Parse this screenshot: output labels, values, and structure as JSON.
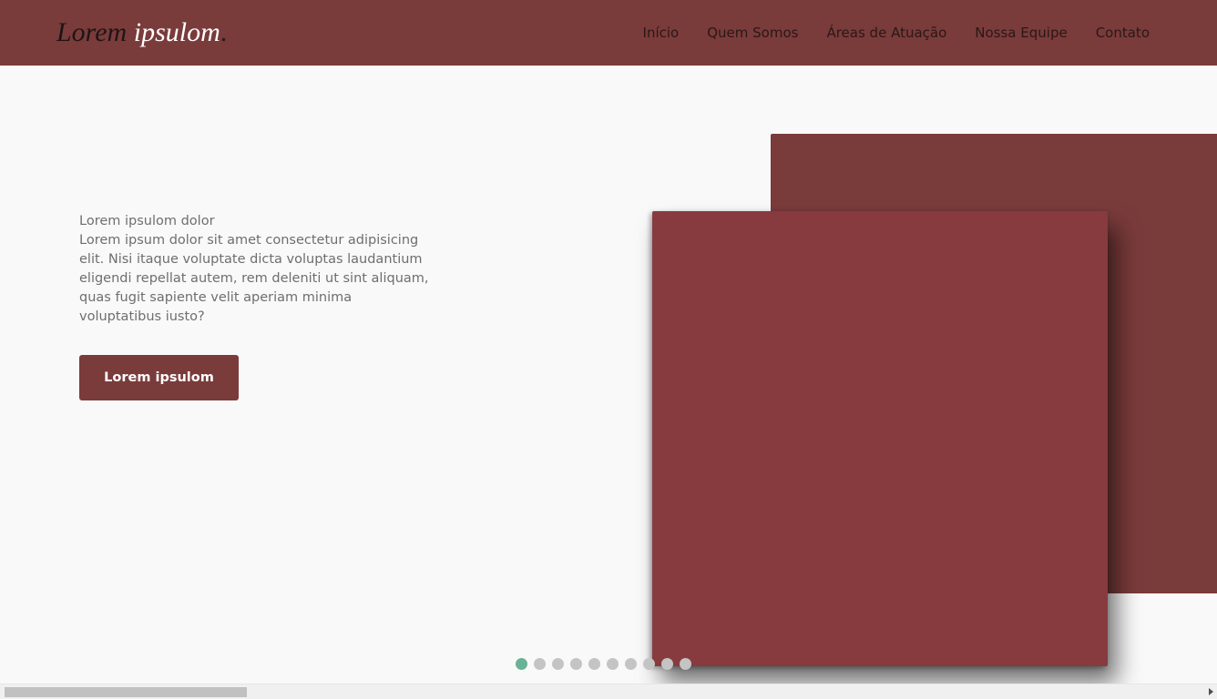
{
  "header": {
    "logo_part1": "Lorem",
    "logo_part2": "ipsulom",
    "logo_dot": ".",
    "nav": [
      "Início",
      "Quem Somos",
      "Áreas de Atuação",
      "Nossa Equipe",
      "Contato"
    ]
  },
  "hero": {
    "heading": "Lorem ipsulom dolor",
    "body": "Lorem ipsum dolor sit amet consectetur adipisicing elit. Nisi itaque voluptate dicta voluptas laudantium eligendi repellat autem, rem deleniti ut sint aliquam, quas fugit sapiente velit aperiam minima voluptatibus iusto?",
    "cta_label": "Lorem ipsulom"
  },
  "carousel": {
    "dot_count": 10,
    "active_index": 0
  },
  "colors": {
    "brand": "#7a3b3b",
    "front_panel": "#873b3f",
    "background": "#f9f9f9",
    "active_dot": "#6ab297",
    "inactive_dot": "#c4c4c4"
  }
}
